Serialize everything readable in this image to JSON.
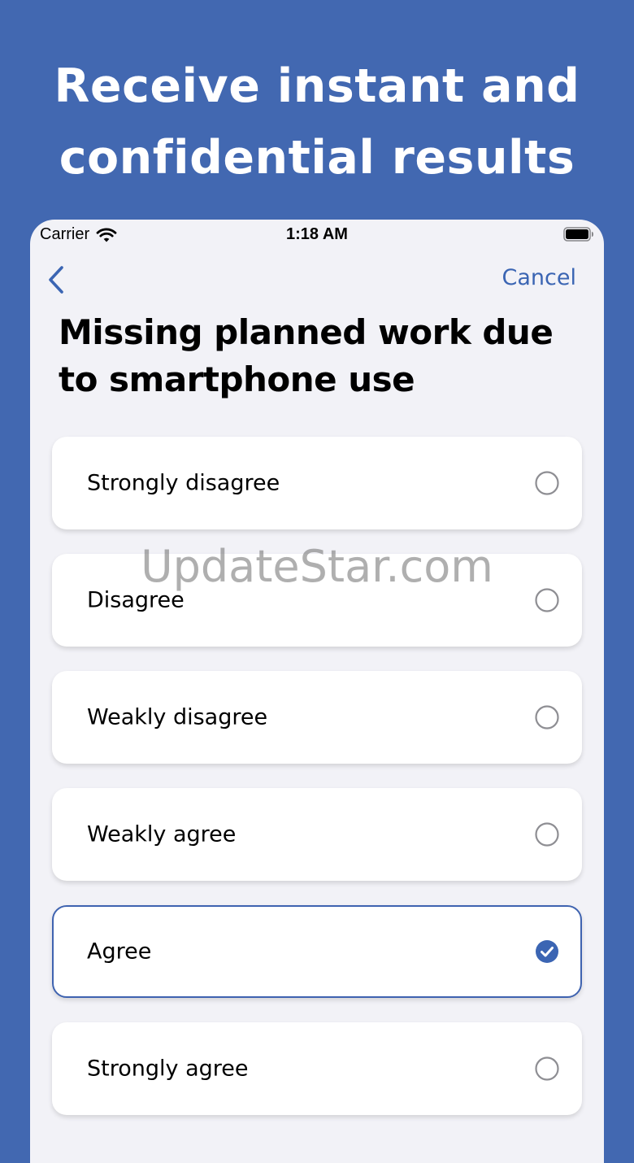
{
  "promo": {
    "headline_line1": "Receive instant and",
    "headline_line2": "confidential results"
  },
  "status_bar": {
    "carrier": "Carrier",
    "time": "1:18 AM",
    "icons": [
      "wifi-icon",
      "battery-icon"
    ]
  },
  "nav": {
    "back_icon": "chevron-left-icon",
    "cancel_label": "Cancel"
  },
  "question": {
    "title": "Missing planned work due to smartphone use"
  },
  "options": [
    {
      "label": "Strongly disagree",
      "selected": false
    },
    {
      "label": "Disagree",
      "selected": false
    },
    {
      "label": "Weakly disagree",
      "selected": false
    },
    {
      "label": "Weakly agree",
      "selected": false
    },
    {
      "label": "Agree",
      "selected": true
    },
    {
      "label": "Strongly agree",
      "selected": false
    }
  ],
  "watermark": "UpdateStar.com",
  "colors": {
    "background": "#4268b1",
    "accent": "#3b65b3",
    "screen": "#f2f2f7",
    "radio_outline": "#8e8e93"
  }
}
